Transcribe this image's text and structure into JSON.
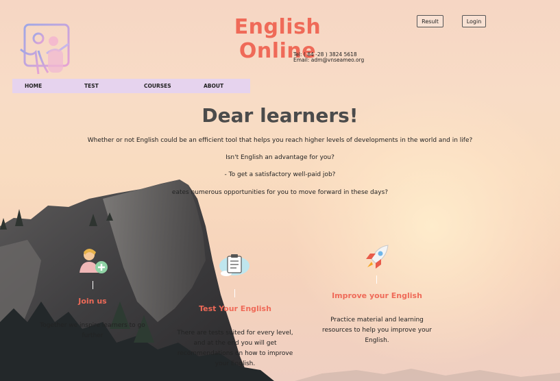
{
  "header": {
    "title": "English Online",
    "contact": {
      "tel": "Tel: ( 84 -28 ) 3824 5618",
      "email": "Email: adm@vnseameo.org"
    },
    "result_label": "Result",
    "login_label": "Login"
  },
  "nav": {
    "items": [
      "HOME",
      "TEST",
      "COURSES",
      "ABOUT"
    ]
  },
  "hero": {
    "title": "Dear learners!",
    "lines": [
      "Whether or not English could be an efficient tool that helps you reach higher levels of developments in the world and in life?",
      "Isn't English an advantage for you?",
      "- To get a satisfactory well-paid job?",
      "eates numerous opportunities for you to move forward in these days?"
    ]
  },
  "features": [
    {
      "title": "Join us",
      "text": "Together we inspire learners to go further",
      "icon": "add-user-icon"
    },
    {
      "title": "Test Your English",
      "text": "There are tests suited for every level, and at the end you will get recommendations on how to improve your English.",
      "icon": "clipboard-test-icon"
    },
    {
      "title": "Improve your English",
      "text": "Practice material and learning resources to help you improve your English.",
      "icon": "rocket-icon"
    }
  ],
  "colors": {
    "accent": "#ef6a58",
    "nav_bg": "#e6d3ee",
    "heading": "#4b4b4b"
  }
}
